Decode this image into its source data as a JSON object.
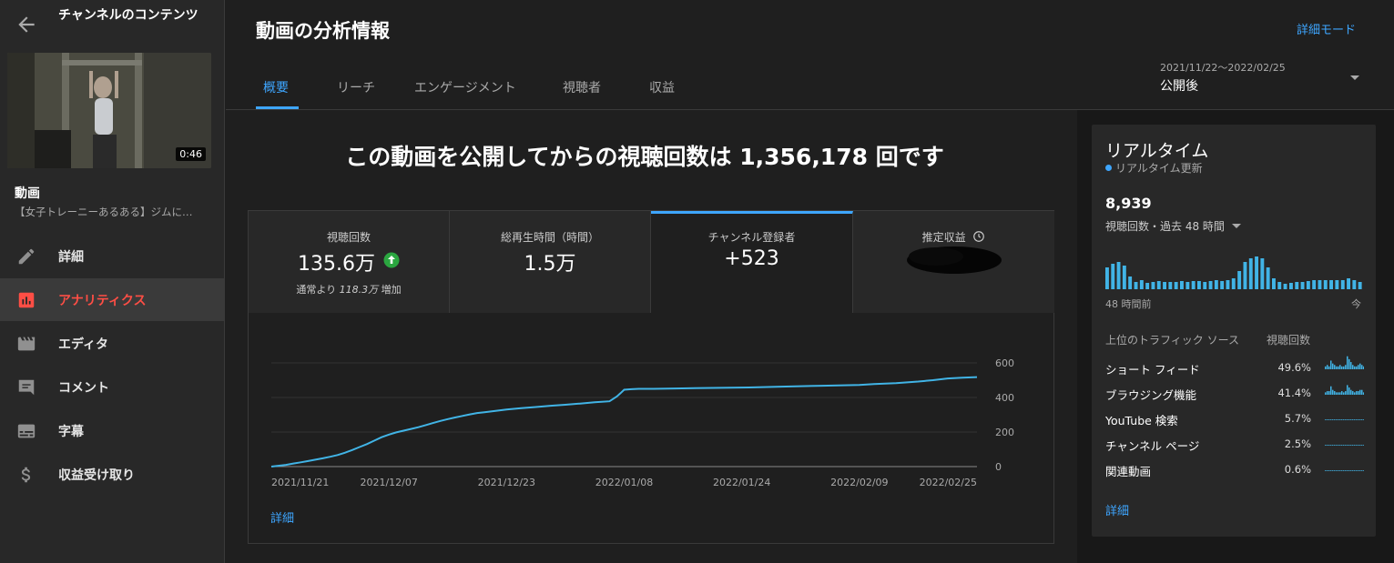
{
  "sidebar": {
    "channel_title": "チャンネルのコンテンツ",
    "thumbnail_duration": "0:46",
    "video_heading": "動画",
    "video_title": "【女子トレーニーあるある】ジムに…",
    "items": [
      {
        "label": "詳細",
        "icon": "pencil-icon"
      },
      {
        "label": "アナリティクス",
        "icon": "analytics-icon",
        "active": true
      },
      {
        "label": "エディタ",
        "icon": "clapperboard-icon"
      },
      {
        "label": "コメント",
        "icon": "comment-icon"
      },
      {
        "label": "字幕",
        "icon": "subtitles-icon"
      },
      {
        "label": "収益受け取り",
        "icon": "dollar-icon"
      }
    ]
  },
  "header": {
    "title": "動画の分析情報",
    "advanced_mode": "詳細モード",
    "tabs": [
      {
        "label": "概要",
        "active": true
      },
      {
        "label": "リーチ"
      },
      {
        "label": "エンゲージメント"
      },
      {
        "label": "視聴者"
      },
      {
        "label": "収益"
      }
    ],
    "date_range": "2021/11/22〜2022/02/25",
    "date_label": "公開後"
  },
  "main": {
    "headline": "この動画を公開してからの視聴回数は 1,356,178 回です",
    "metrics": [
      {
        "label": "視聴回数",
        "value": "135.6万",
        "sub_prefix": "通常より",
        "sub_value": "118.3万",
        "sub_suffix": "増加"
      },
      {
        "label": "総再生時間（時間）",
        "value": "1.5万"
      },
      {
        "label": "チャンネル登録者",
        "value": "+523",
        "selected": true
      },
      {
        "label": "推定収益",
        "value": ""
      }
    ],
    "details_link": "詳細"
  },
  "chart_data": {
    "type": "line",
    "title": "",
    "xlabel": "",
    "ylabel": "",
    "ylim": [
      0,
      600
    ],
    "yticks": [
      0,
      200,
      400,
      600
    ],
    "xtick_labels": [
      "2021/11/21",
      "2021/12/07",
      "2021/12/23",
      "2022/01/08",
      "2022/01/24",
      "2022/02/09",
      "2022/02/25"
    ],
    "xtick_days": [
      0,
      16,
      32,
      48,
      64,
      80,
      96
    ],
    "x": [
      0,
      2,
      3,
      4,
      5,
      6,
      7,
      8,
      9,
      10,
      11,
      12,
      13,
      14,
      15,
      16,
      17,
      18,
      19,
      20,
      21,
      22,
      23,
      24,
      25,
      26,
      27,
      28,
      29,
      30,
      31,
      32,
      34,
      36,
      38,
      40,
      42,
      44,
      46,
      47,
      47.5,
      48,
      49,
      50,
      52,
      55,
      60,
      65,
      70,
      75,
      80,
      82,
      85,
      88,
      90,
      92,
      94,
      96
    ],
    "series": [
      {
        "values": [
          0,
          10,
          18,
          25,
          32,
          40,
          48,
          57,
          67,
          80,
          96,
          113,
          130,
          150,
          170,
          185,
          198,
          208,
          218,
          228,
          240,
          252,
          264,
          275,
          284,
          293,
          302,
          310,
          315,
          320,
          325,
          330,
          338,
          345,
          352,
          358,
          365,
          372,
          378,
          405,
          425,
          445,
          448,
          450,
          450,
          452,
          455,
          458,
          463,
          468,
          472,
          478,
          483,
          492,
          500,
          510,
          515,
          518
        ]
      }
    ],
    "grid": true
  },
  "realtime": {
    "title": "リアルタイム",
    "update_label": "リアルタイム更新",
    "count": "8,939",
    "metric_label": "視聴回数・過去 48 時間",
    "hourly_views": [
      24,
      28,
      30,
      26,
      14,
      8,
      10,
      7,
      8,
      9,
      8,
      8,
      8,
      9,
      8,
      9,
      9,
      8,
      9,
      10,
      9,
      10,
      12,
      20,
      30,
      34,
      36,
      34,
      24,
      12,
      8,
      6,
      7,
      8,
      8,
      9,
      10,
      10,
      10,
      10,
      10,
      10,
      12,
      10,
      8
    ],
    "start_label": "48 時間前",
    "end_label": "今",
    "traffic_header": "上位のトラフィック ソース",
    "traffic_col": "視聴回数",
    "traffic_sources": [
      {
        "name": "ショート フィード",
        "pct": "49.6%",
        "pct_value": 49.6
      },
      {
        "name": "ブラウジング機能",
        "pct": "41.4%",
        "pct_value": 41.4
      },
      {
        "name": "YouTube 検索",
        "pct": "5.7%",
        "pct_value": 5.7
      },
      {
        "name": "チャンネル ページ",
        "pct": "2.5%",
        "pct_value": 2.5
      },
      {
        "name": "関連動画",
        "pct": "0.6%",
        "pct_value": 0.6
      }
    ],
    "details_link": "詳細"
  },
  "colors": {
    "accent": "#3ea6ff",
    "active_nav": "#ff4e45",
    "chart_line": "#41b4e6",
    "up_arrow": "#2ba640"
  }
}
